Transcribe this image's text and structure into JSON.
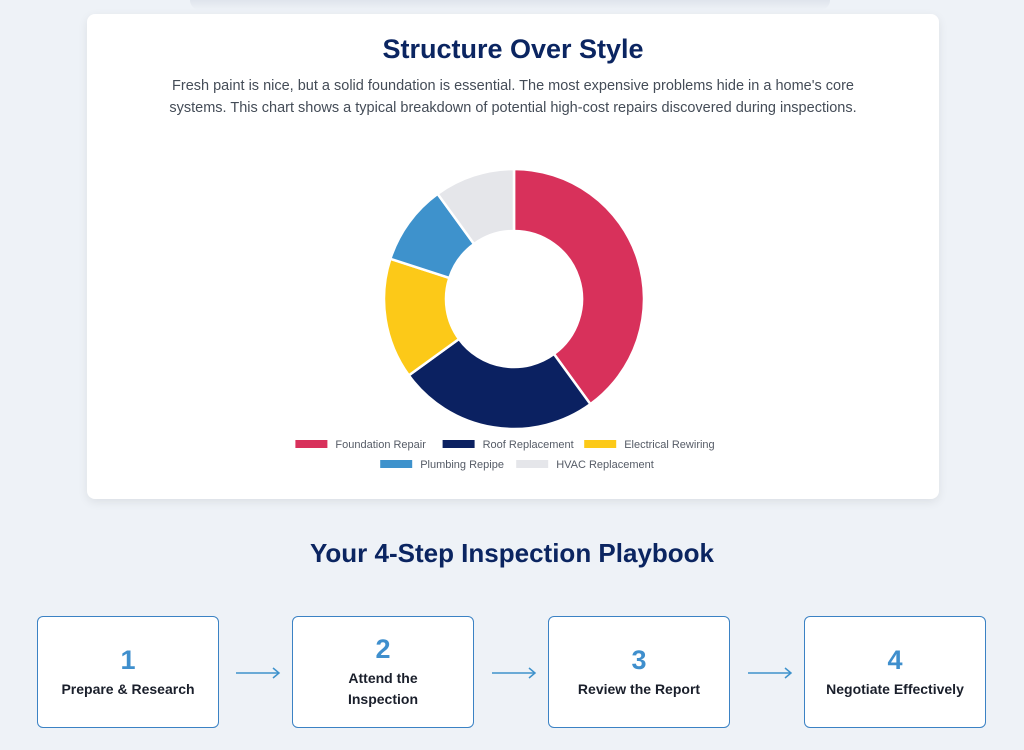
{
  "chart_section": {
    "title": "Structure Over Style",
    "description": "Fresh paint is nice, but a solid foundation is essential. The most expensive problems hide in a home's core systems. This chart shows a typical breakdown of potential high-cost repairs discovered during inspections."
  },
  "chart_data": {
    "type": "pie",
    "variant": "doughnut",
    "categories": [
      "Foundation Repair",
      "Roof Replacement",
      "Electrical Rewiring",
      "Plumbing Repipe",
      "HVAC Replacement"
    ],
    "values": [
      40,
      25,
      15,
      10,
      10
    ],
    "colors": [
      "#d8315b",
      "#0b2161",
      "#fcc918",
      "#3e92cc",
      "#e5e6ea"
    ],
    "legend_position": "bottom"
  },
  "playbook": {
    "title": "Your 4-Step Inspection Playbook",
    "steps": [
      {
        "number": "1",
        "label": "Prepare & Research"
      },
      {
        "number": "2",
        "label": "Attend the Inspection"
      },
      {
        "number": "3",
        "label": "Review the Report"
      },
      {
        "number": "4",
        "label": "Negotiate Effectively"
      }
    ],
    "arrow_color": "#3e92cc"
  }
}
